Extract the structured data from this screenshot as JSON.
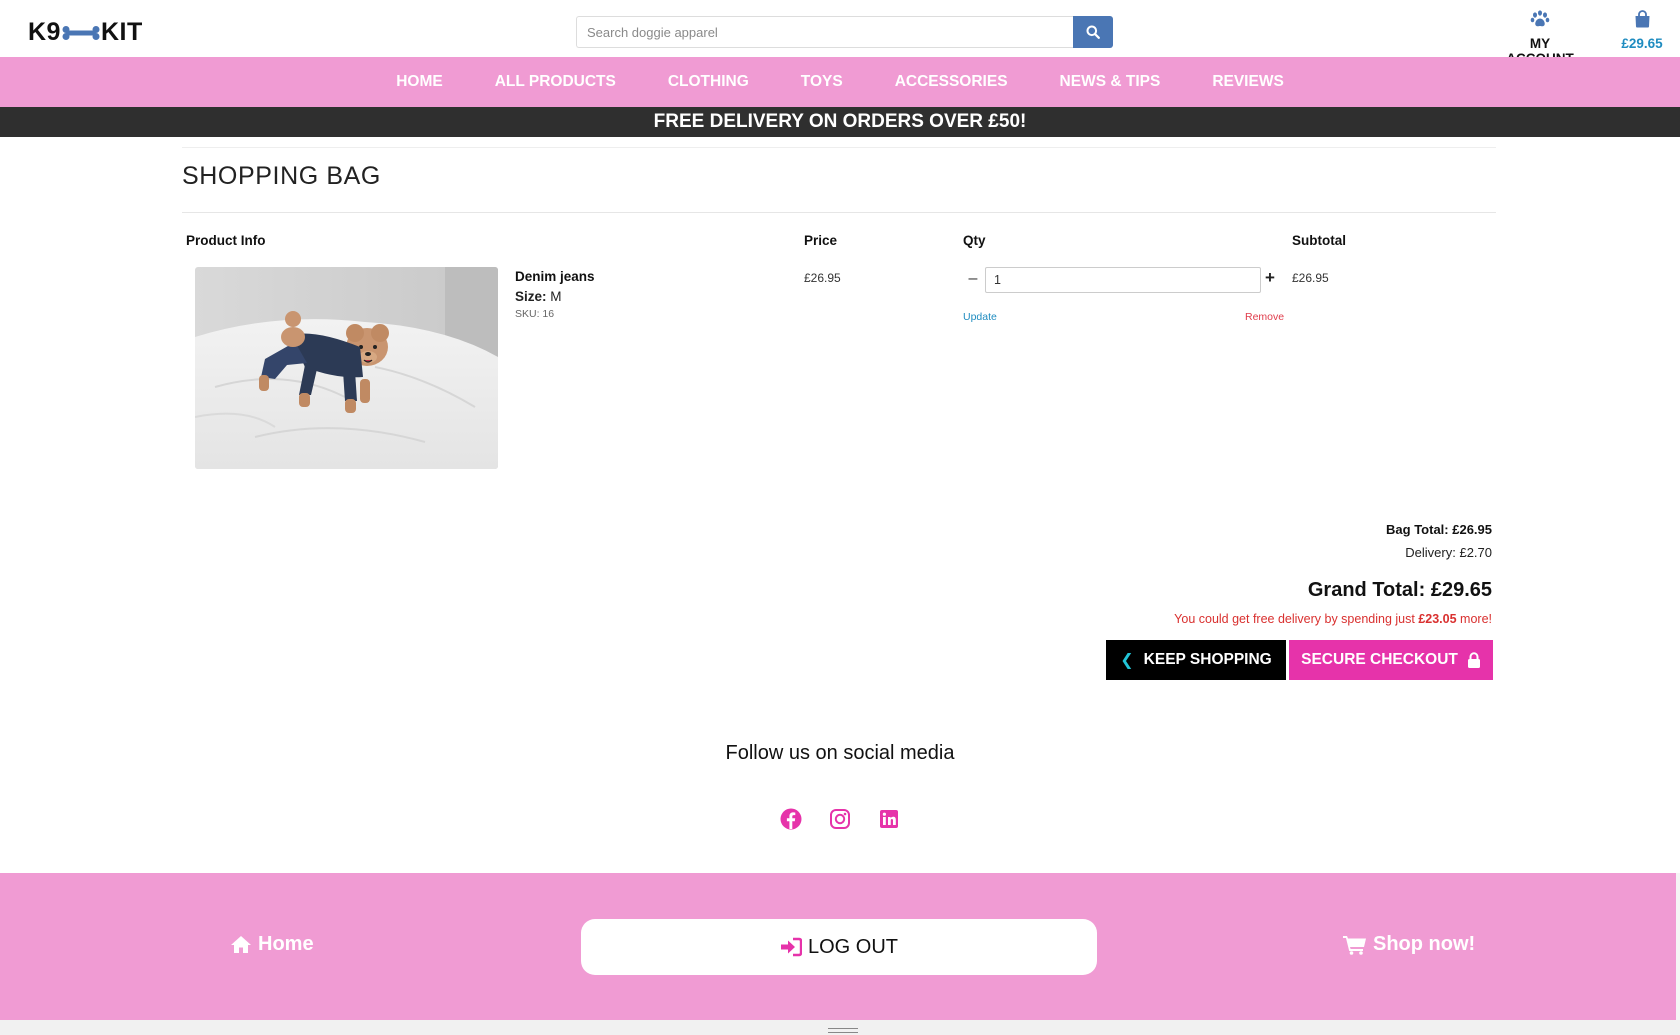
{
  "brand": {
    "logo_left": "K9",
    "logo_right": "KIT"
  },
  "search": {
    "placeholder": "Search doggie apparel"
  },
  "account": {
    "label": "MY ACCOUNT"
  },
  "bag": {
    "total": "£29.65"
  },
  "nav": {
    "items": [
      {
        "label": "HOME"
      },
      {
        "label": "ALL PRODUCTS"
      },
      {
        "label": "CLOTHING"
      },
      {
        "label": "TOYS"
      },
      {
        "label": "ACCESSORIES"
      },
      {
        "label": "NEWS & TIPS"
      },
      {
        "label": "REVIEWS"
      }
    ]
  },
  "banner": {
    "text": "FREE DELIVERY ON ORDERS OVER £50!"
  },
  "page": {
    "title": "SHOPPING BAG"
  },
  "table": {
    "headers": {
      "product": "Product Info",
      "price": "Price",
      "qty": "Qty",
      "subtotal": "Subtotal"
    },
    "rows": [
      {
        "name": "Denim jeans",
        "size_label": "Size:",
        "size": "M",
        "sku": "SKU: 16",
        "price": "£26.95",
        "qty": "1",
        "subtotal": "£26.95",
        "update": "Update",
        "remove": "Remove"
      }
    ]
  },
  "totals": {
    "bag_total": "Bag Total: £26.95",
    "delivery": "Delivery: £2.70",
    "grand_total": "Grand Total: £29.65",
    "free_prefix": "You could get free delivery by spending just",
    "free_amount": "£23.05",
    "free_suffix": "more!"
  },
  "buttons": {
    "keep_shopping": "KEEP SHOPPING",
    "checkout": "SECURE CHECKOUT"
  },
  "social": {
    "title": "Follow us on social media"
  },
  "footer": {
    "home": "Home",
    "logout": "LOG OUT",
    "shop": "Shop now!"
  },
  "colors": {
    "pink": "#f09bd3",
    "magenta": "#e633aa",
    "blue": "#4a76b4",
    "dark": "#2f2f2f",
    "link": "#1f8cc0",
    "alert": "#d9302f"
  }
}
